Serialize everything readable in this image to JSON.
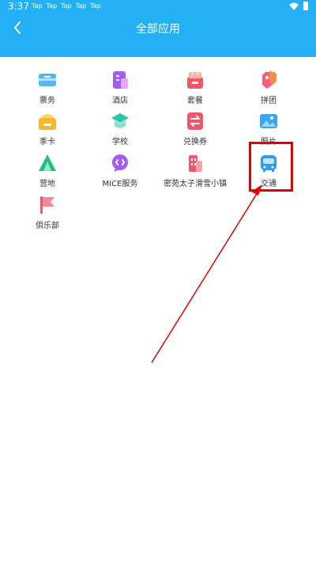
{
  "status_bar": {
    "time": "3:37",
    "notifications": [
      "Tap",
      "Tap",
      "Tap",
      "Tap",
      "Tap"
    ]
  },
  "header": {
    "title": "全部应用",
    "background": "#23b0f5"
  },
  "apps": [
    {
      "label": "票务",
      "icon": "ticket-icon"
    },
    {
      "label": "酒店",
      "icon": "hotel-icon"
    },
    {
      "label": "套餐",
      "icon": "package-icon"
    },
    {
      "label": "拼团",
      "icon": "group-buy-icon"
    },
    {
      "label": "季卡",
      "icon": "season-card-icon"
    },
    {
      "label": "学校",
      "icon": "school-icon"
    },
    {
      "label": "兑换券",
      "icon": "voucher-icon"
    },
    {
      "label": "照片",
      "icon": "photo-icon"
    },
    {
      "label": "营地",
      "icon": "camp-icon"
    },
    {
      "label": "MICE服务",
      "icon": "mice-service-icon"
    },
    {
      "label": "密苑太子滑雪小镇",
      "icon": "ski-town-icon"
    },
    {
      "label": "交通",
      "icon": "bus-icon"
    },
    {
      "label": "俱乐部",
      "icon": "club-flag-icon"
    }
  ],
  "annotation": {
    "color": "#e30000",
    "target": "交通"
  }
}
